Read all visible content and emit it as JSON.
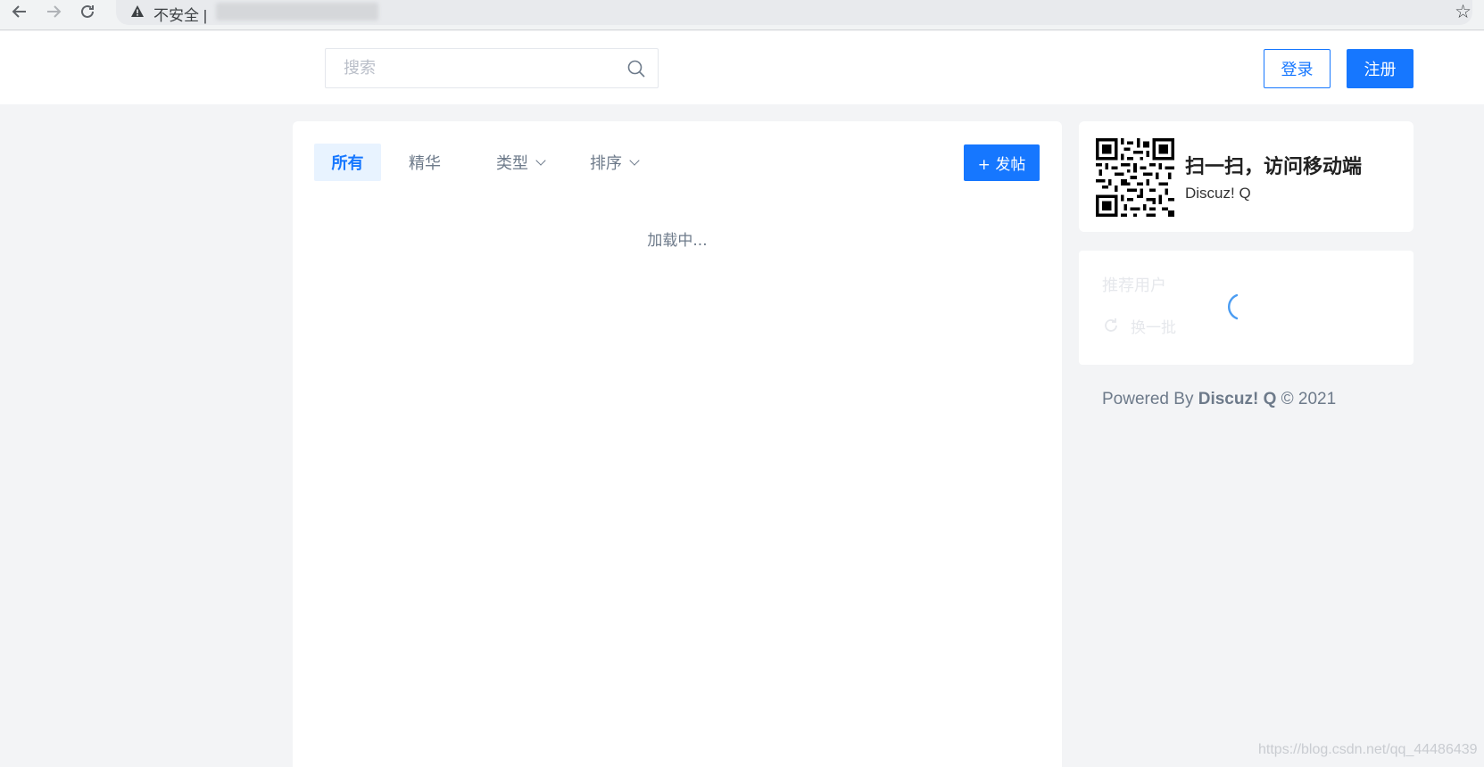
{
  "browser": {
    "back_icon": "arrow-left-icon",
    "forward_icon": "arrow-right-icon",
    "reload_icon": "reload-icon",
    "security_label": "不安全 |",
    "bookmark_icon": "star-icon"
  },
  "header": {
    "search_placeholder": "搜索",
    "login_label": "登录",
    "register_label": "注册"
  },
  "tabs": [
    {
      "label": "所有",
      "active": true
    },
    {
      "label": "精华",
      "active": false
    },
    {
      "label": "类型",
      "active": false,
      "dropdown": true
    },
    {
      "label": "排序",
      "active": false,
      "dropdown": true
    }
  ],
  "main": {
    "post_button_label": "+ 发帖",
    "loading_text": "加载中..."
  },
  "qr_card": {
    "title": "扫一扫，访问移动端",
    "subtitle": "Discuz! Q"
  },
  "recommended": {
    "title": "推荐用户",
    "refresh_label": "换一批"
  },
  "footer": {
    "powered_prefix": "Powered By",
    "brand": "Discuz! Q",
    "copyright": "© 2021"
  },
  "watermark": "https://blog.csdn.net/qq_44486439",
  "colors": {
    "accent": "#1677ff",
    "background": "#f3f4f6",
    "muted_text": "#6d7a8a"
  }
}
